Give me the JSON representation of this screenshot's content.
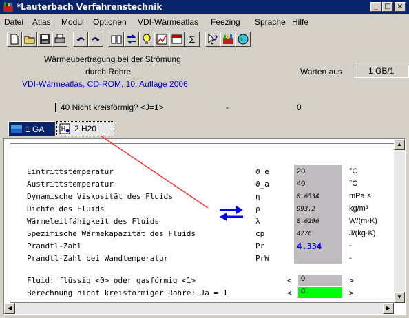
{
  "window": {
    "title": "*Lauterbach Verfahrenstechnik",
    "min": "_",
    "max": "□",
    "close": "×"
  },
  "menu": [
    "Datei",
    "Atlas",
    "Modul",
    "Optionen",
    "VDI-Wärmeatlas",
    "Feezing",
    "Sprache",
    "Hilfe"
  ],
  "toolbar": {
    "sum_label": "Σ"
  },
  "header": {
    "line1": "Wärmeübertragung bei der Strömung",
    "line2": "durch Rohre",
    "source": "VDI-Wärmeatlas, CD-ROM, 10. Auflage 2006",
    "status_label": "Warten aus",
    "status_value": "1 GB/1",
    "option_label": "40 Nicht kreisförmig? <J=1>",
    "option_sep": "-",
    "option_value": "0"
  },
  "tabs": [
    {
      "label": "1 GA"
    },
    {
      "label": "2 H20"
    }
  ],
  "table": {
    "rows": [
      {
        "label": "Eintrittstemperatur",
        "symbol": "ϑ_e",
        "value": "20",
        "unit": "°C"
      },
      {
        "label": "Austrittstemperatur",
        "symbol": "ϑ_a",
        "value": "40",
        "unit": "°C"
      },
      {
        "label": "Dynamische Viskosität des Fluids",
        "symbol": "η",
        "value": "0.6534",
        "unit": "mPa·s"
      },
      {
        "label": "Dichte des Fluids",
        "symbol": "ρ",
        "value": "993.2",
        "unit": "kg/m³"
      },
      {
        "label": "Wärmeleitfähigkeit des Fluids",
        "symbol": "λ",
        "value": "0.6296",
        "unit": "W/(m·K)"
      },
      {
        "label": "Spezifische Wärmekapazität des Fluids",
        "symbol": "cp",
        "value": "4276",
        "unit": "J/(kg·K)"
      },
      {
        "label": "Prandtl-Zahl",
        "symbol": "Pr",
        "value": "4.334",
        "unit": "-"
      },
      {
        "label": "Prandtl-Zahl bei Wandtemperatur",
        "symbol": "PrW",
        "value": "",
        "unit": "-"
      }
    ],
    "fluid": {
      "label": "Fluid: flüssig <0> oder gasförmig <1>",
      "lt": "<",
      "value": "0",
      "gt": ">"
    },
    "calc": {
      "label": "Berechnung nicht kreisförmiger Rohre: Ja = 1",
      "lt": "<",
      "value": "0",
      "gt": ">"
    }
  },
  "colors": {
    "titlebar": "#0a246a",
    "computed_value": "#0000ff",
    "highlight_input": "#00ff00",
    "swap_arrows": "#0000ff",
    "pointer_line": "#ff3030"
  }
}
